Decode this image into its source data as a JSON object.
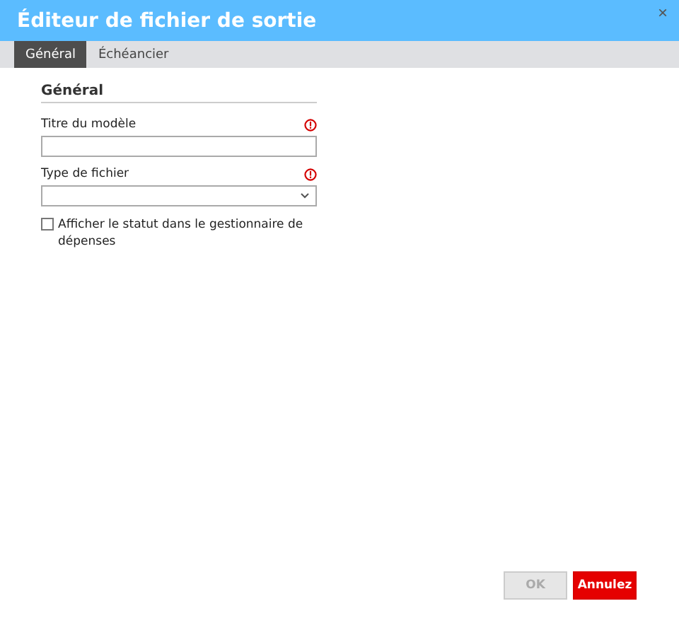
{
  "window": {
    "title": "Éditeur de fichier de sortie",
    "close": "×"
  },
  "tabs": [
    {
      "label": "Général",
      "selected": true
    },
    {
      "label": "Échéancier",
      "selected": false
    }
  ],
  "section": {
    "title": "Général"
  },
  "fields": [
    {
      "kind": "text",
      "label": "Titre du modèle",
      "required": true
    },
    {
      "kind": "select",
      "label": "Type de fichier",
      "required": true
    }
  ],
  "checkbox": {
    "label": "Afficher le statut dans le gestionnaire de dépenses",
    "checked": false
  },
  "buttons": [
    {
      "label": "OK",
      "kind": "secondary",
      "disabled": true
    },
    {
      "label": "Annulez",
      "kind": "primary",
      "disabled": false
    }
  ]
}
